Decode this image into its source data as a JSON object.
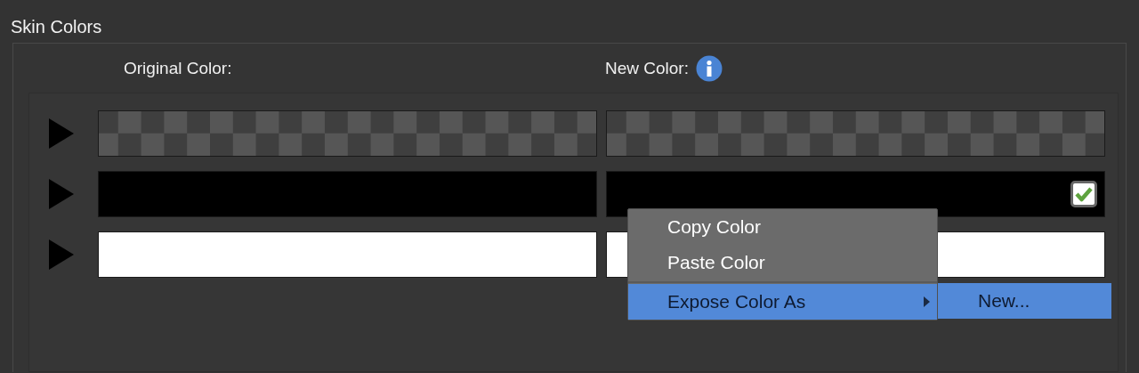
{
  "section": {
    "title": "Skin Colors"
  },
  "columns": [
    {
      "label": "Original Color:",
      "info": false
    },
    {
      "label": "New Color:",
      "info": true
    }
  ],
  "rows": [
    {
      "original": {
        "kind": "transparent"
      },
      "new": {
        "kind": "transparent"
      }
    },
    {
      "original": {
        "kind": "solid",
        "color": "#000000"
      },
      "new": {
        "kind": "solid",
        "color": "#000000",
        "checkbox": {
          "checked": true
        }
      }
    },
    {
      "original": {
        "kind": "solid",
        "color": "#ffffff"
      },
      "new": {
        "kind": "solid",
        "color": "#ffffff"
      }
    }
  ],
  "context_menu": {
    "items": [
      {
        "label": "Copy Color",
        "selected": false,
        "submenu": false
      },
      {
        "label": "Paste Color",
        "selected": false,
        "submenu": false
      },
      {
        "label": "Expose Color As",
        "selected": true,
        "submenu": true
      }
    ],
    "submenu": {
      "items": [
        {
          "label": "New...",
          "selected": true
        }
      ]
    }
  }
}
